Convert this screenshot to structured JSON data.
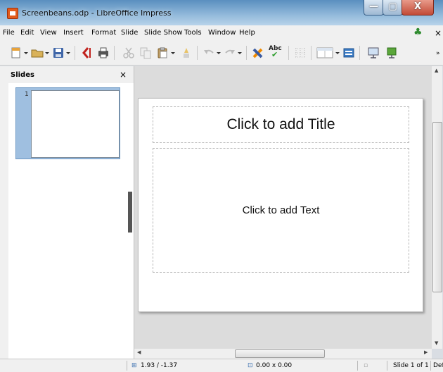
{
  "window": {
    "title": "Screenbeans.odp - LibreOffice Impress",
    "buttons": {
      "minimize": "—",
      "maximize": "▢",
      "close": "X"
    }
  },
  "menubar": {
    "items": [
      "File",
      "Edit",
      "View",
      "Insert",
      "Format",
      "Slide",
      "Slide Show",
      "Tools",
      "Window",
      "Help"
    ],
    "close_glyph": "×"
  },
  "toolbar": {
    "icons": [
      "new-document-icon",
      "open-folder-icon",
      "save-icon",
      "export-pdf-icon",
      "print-icon",
      "cut-icon",
      "copy-icon",
      "paste-icon",
      "clone-formatting-icon",
      "undo-icon",
      "redo-icon",
      "find-replace-icon",
      "spellcheck-icon",
      "grid-icon",
      "table-icon",
      "image-icon",
      "slide-show-icon",
      "presentation-icon"
    ],
    "spellcheck_label": "Abc"
  },
  "slides_panel": {
    "title": "Slides",
    "close_glyph": "×",
    "slides": [
      {
        "number": "1"
      }
    ]
  },
  "slide": {
    "title_placeholder": "Click to add Title",
    "text_placeholder": "Click to add Text"
  },
  "statusbar": {
    "position": "1.93 / -1.37",
    "size": "0.00 x 0.00",
    "slide_info": "Slide 1 of 1",
    "layout": "Def"
  },
  "colors": {
    "title_bar": "#5a8fbf",
    "close_button": "#c24a36",
    "selection": "#9fbfe0"
  }
}
